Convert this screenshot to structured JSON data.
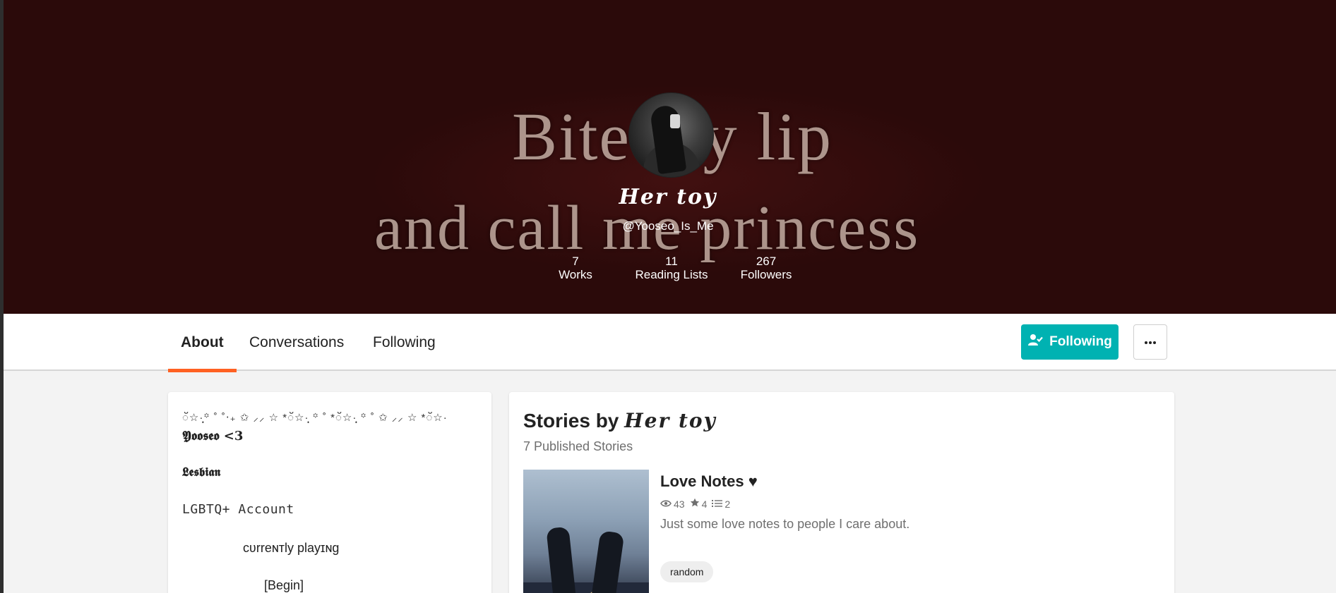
{
  "banner": {
    "line1": "Bite my lip",
    "line2": "and call me princess",
    "background_color": "#2b0a0a"
  },
  "profile": {
    "display_name": "𝑯𝒆𝒓 𝒕𝒐𝒚",
    "username": "@Yooseo_Is_Me",
    "stats": [
      {
        "value": "7",
        "label": "Works"
      },
      {
        "value": "11",
        "label": "Reading Lists"
      },
      {
        "value": "267",
        "label": "Followers"
      }
    ]
  },
  "nav": {
    "tabs": [
      {
        "label": "About",
        "active": true
      },
      {
        "label": "Conversations",
        "active": false
      },
      {
        "label": "Following",
        "active": false
      }
    ],
    "follow_button": {
      "label": "Following",
      "icon": "user-check-icon",
      "color": "#00b2b2"
    },
    "more_button": {
      "icon": "ellipsis-icon",
      "label": "···"
    },
    "active_tab_color": "#ff6122"
  },
  "about": {
    "lines": [
      "ॅ☆·̩͙꙳ ˚ ˚‧₊ ✩ ⸝⸝ ☆ *ॅ☆·̩͙ ꙳ ˚ *ॅ☆·̩͙ ꙳ ˚ ✩ ⸝⸝ ☆ *ॅ☆·",
      "𝖄𝖔𝖔𝖘𝖊𝖔 <3",
      "𝕷𝖊𝖘𝖇𝖎𝖆𝖓",
      "LGBTQ+ Account",
      "cʋrreɴтly playɪɴg",
      "[Begin]"
    ]
  },
  "stories": {
    "title_prefix": "Stories by",
    "title_name": "𝑯𝒆𝒓 𝒕𝒐𝒚",
    "subtitle": "7 Published Stories",
    "items": [
      {
        "title": "Love Notes ♥",
        "reads": "43",
        "votes": "4",
        "parts": "2",
        "description": "Just some love notes to people I care about.",
        "tag": "random"
      }
    ]
  }
}
